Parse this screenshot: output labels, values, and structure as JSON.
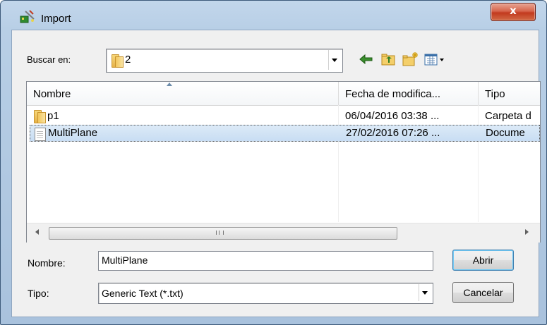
{
  "window": {
    "title": "Import",
    "close_label": "x"
  },
  "look_in": {
    "label": "Buscar en:",
    "value": "2"
  },
  "toolbar": [
    "back-icon",
    "up-folder-icon",
    "new-folder-icon",
    "view-menu-icon"
  ],
  "columns": {
    "name": "Nombre",
    "date": "Fecha de modifica...",
    "type": "Tipo"
  },
  "files": [
    {
      "name": "p1",
      "date": "06/04/2016 03:38 ...",
      "type": "Carpeta d",
      "icon": "folder-icon",
      "selected": false
    },
    {
      "name": "MultiPlane",
      "date": "27/02/2016 07:26 ...",
      "type": "Docume",
      "icon": "text-file-icon",
      "selected": true
    }
  ],
  "scrollbar": {
    "grip": "III"
  },
  "filename": {
    "label": "Nombre:",
    "value": "MultiPlane"
  },
  "filetype": {
    "label": "Tipo:",
    "value": "Generic Text (*.txt)"
  },
  "buttons": {
    "open": "Abrir",
    "cancel": "Cancelar"
  },
  "colors": {
    "selection": "#c8ddf3",
    "titlebar": "#b8cfe6",
    "close": "#c23a1e"
  }
}
